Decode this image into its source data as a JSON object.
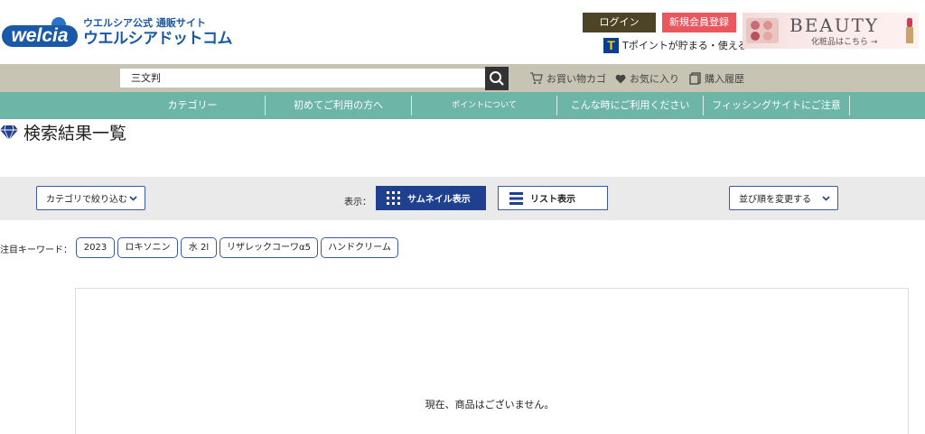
{
  "header": {
    "logo_mark": "welcia",
    "logo_sub": "ウエルシア公式 通販サイト",
    "logo_main": "ウエルシアドットコム",
    "login_label": "ログイン",
    "register_label": "新規会員登録",
    "tpoint_text": "Tポイントが貯まる・使える",
    "beauty_title": "BEAUTY",
    "beauty_sub": "化粧品はこちら →"
  },
  "search": {
    "value": "三文判",
    "cart_label": "お買い物カゴ",
    "favorites_label": "お気に入り",
    "history_label": "購入履歴"
  },
  "nav": {
    "items": [
      {
        "label": "カテゴリー"
      },
      {
        "label": "初めてご利用の方へ"
      },
      {
        "label": "ポイントについて"
      },
      {
        "label": "こんな時にご利用ください"
      },
      {
        "label": "フィッシングサイトにご注意"
      }
    ]
  },
  "page": {
    "title": "検索結果一覧"
  },
  "toolbar": {
    "category_filter_label": "カテゴリで絞り込む",
    "display_label": "表示：",
    "thumbnail_label": "サムネイル表示",
    "list_label": "リスト表示",
    "sort_label": "並び順を変更する"
  },
  "keywords": {
    "label": "注目キーワード：",
    "tags": [
      "2023",
      "ロキソニン",
      "水 2l",
      "リザレックコーワα5",
      "ハンドクリーム"
    ]
  },
  "results": {
    "empty_message": "現在、商品はございません。"
  },
  "colors": {
    "brand_blue": "#1a59a8",
    "nav_teal": "#6db5a6",
    "search_band": "#c8c4b3",
    "login_bg": "#4d4427",
    "register_bg": "#e9585f",
    "active_view": "#1f3f8f"
  }
}
